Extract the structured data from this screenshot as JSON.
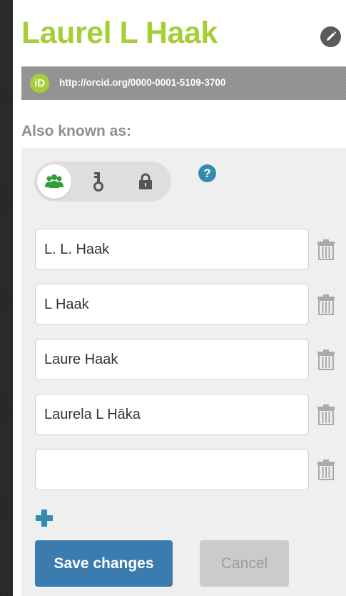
{
  "header": {
    "name": "Laurel L Haak",
    "edit_icon": "pencil-icon"
  },
  "orcid": {
    "logo_text": "iD",
    "url": "http://orcid.org/0000-0001-5109-3700"
  },
  "also_known_as": {
    "label": "Also known as:",
    "visibility": {
      "options": [
        "everyone-icon",
        "key-icon",
        "lock-icon"
      ],
      "selected": "everyone-icon"
    },
    "help_icon": "?",
    "names": [
      {
        "value": "L. L. Haak"
      },
      {
        "value": "L Haak"
      },
      {
        "value": "Laure Haak"
      },
      {
        "value": "Laurela L Hāka"
      },
      {
        "value": ""
      }
    ],
    "add_icon": "plus-icon"
  },
  "actions": {
    "save_label": "Save changes",
    "cancel_label": "Cancel"
  },
  "colors": {
    "name": "#a6ce39",
    "orcid_green": "#a6ce39",
    "accent_blue": "#338caf",
    "save_button": "#3a7bb0",
    "cancel_button": "#cbcbcb"
  }
}
